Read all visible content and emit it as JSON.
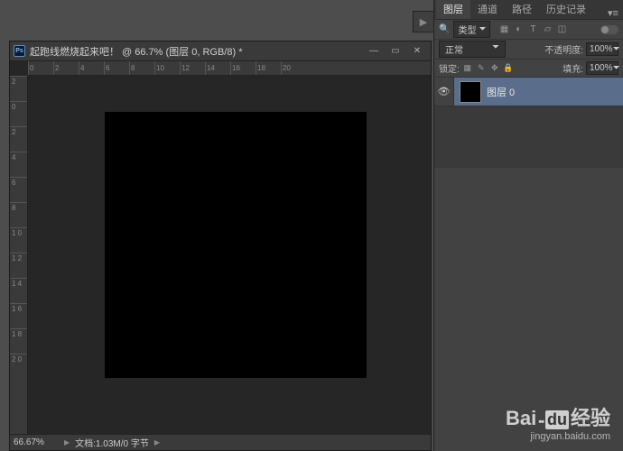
{
  "document": {
    "title": "起跑线燃烧起来吧！ @ 66.7% (图层 0, RGB/8) *",
    "zoom": "66.67%",
    "docinfo": "文档:1.03M/0 字节"
  },
  "ruler": {
    "h": [
      "0",
      "2",
      "4",
      "6",
      "8",
      "10",
      "12",
      "14",
      "16",
      "18",
      "20"
    ],
    "v": [
      "2",
      "0",
      "2",
      "4",
      "6",
      "8",
      "1\n0",
      "1\n2",
      "1\n4",
      "1\n6",
      "1\n8",
      "2\n0"
    ]
  },
  "panels": {
    "tabs": [
      "图层",
      "通道",
      "路径",
      "历史记录"
    ],
    "kind": "类型",
    "blend": "正常",
    "opacity_label": "不透明度:",
    "opacity_value": "100%",
    "lock_label": "锁定:",
    "fill_label": "填充:",
    "fill_value": "100%"
  },
  "layers": [
    {
      "name": "图层 0",
      "visible": true
    }
  ],
  "watermark": {
    "brand1": "Bai",
    "brand2": "du",
    "brand3": "经验",
    "url": "jingyan.baidu.com"
  }
}
